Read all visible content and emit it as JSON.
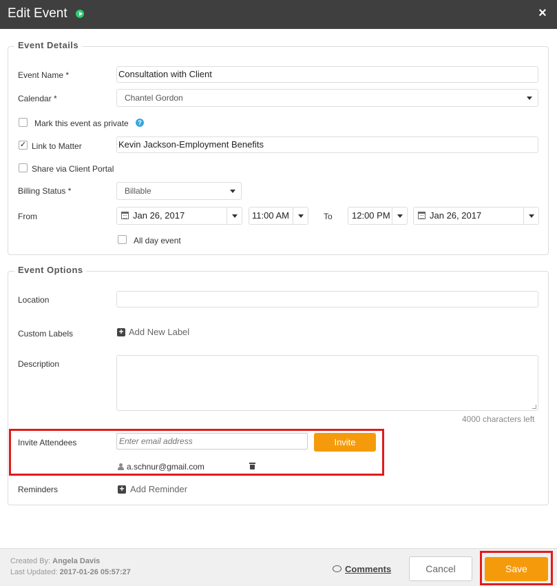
{
  "dialog": {
    "title": "Edit Event",
    "close_glyph": "×"
  },
  "event_details": {
    "legend": "Event Details",
    "event_name_label": "Event Name *",
    "event_name_value": "Consultation with Client",
    "calendar_label": "Calendar *",
    "calendar_value": "Chantel Gordon",
    "private_label": "Mark this event as private",
    "private_checked": false,
    "link_matter_label": "Link to Matter",
    "link_matter_checked": true,
    "link_matter_check_glyph": "✓",
    "matter_value": "Kevin Jackson-Employment Benefits",
    "share_portal_label": "Share via Client Portal",
    "share_portal_checked": false,
    "billing_label": "Billing Status *",
    "billing_value": "Billable",
    "from_label": "From",
    "from_date": "Jan 26, 2017",
    "from_time": "11:00 AM",
    "to_label": "To",
    "to_time": "12:00 PM",
    "to_date": "Jan 26, 2017",
    "all_day_label": "All day event",
    "all_day_checked": false
  },
  "event_options": {
    "legend": "Event Options",
    "location_label": "Location",
    "location_value": "",
    "custom_labels_label": "Custom Labels",
    "add_label_text": "Add New Label",
    "description_label": "Description",
    "description_value": "",
    "chars_left": "4000 characters left",
    "invite_label": "Invite Attendees",
    "email_placeholder": "Enter email address",
    "invite_button": "Invite",
    "attendee_email": "a.schnur@gmail.com",
    "reminders_label": "Reminders",
    "add_reminder_text": "Add Reminder"
  },
  "footer": {
    "created_by_label": "Created By:",
    "created_by": "Angela Davis",
    "last_updated_label": "Last Updated:",
    "last_updated": "2017-01-26 05:57:27",
    "comments_label": "Comments",
    "cancel_label": "Cancel",
    "save_label": "Save"
  },
  "colors": {
    "titlebar": "#3f3f3f",
    "accent_orange": "#f59b0b",
    "highlight_red": "#e11b1b",
    "status_green": "#2ecc71",
    "help_blue": "#3aa6dd"
  }
}
